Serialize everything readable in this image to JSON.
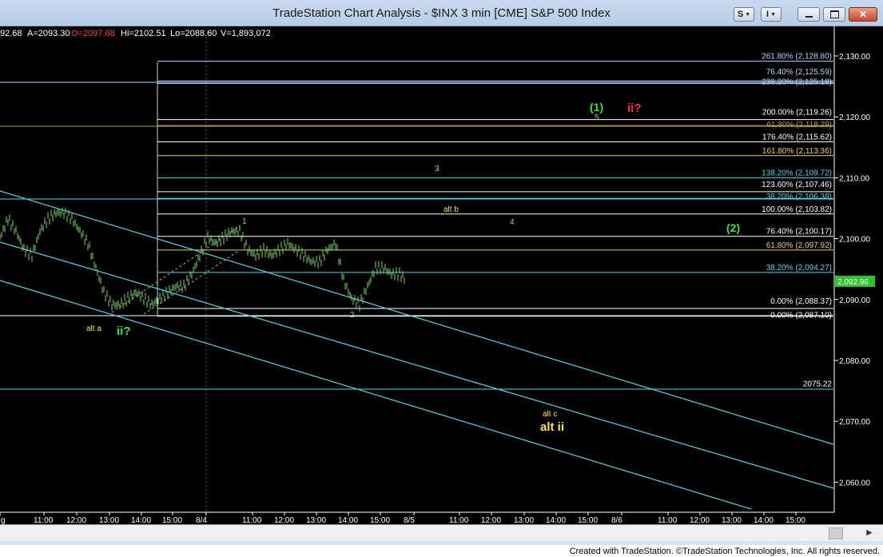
{
  "window": {
    "title": "TradeStation Chart Analysis - $INX 3 min [CME] S&P 500 Index",
    "buttons": {
      "s_label": "S",
      "i_label": "I"
    }
  },
  "status_line": {
    "close_partial": "92.68",
    "ask": "A=2093.30",
    "open": "O=2097.68",
    "high": "Hi=2102.51",
    "low": "Lo=2088.60",
    "volume": "V=1,893,072"
  },
  "price_axis": {
    "ticks": [
      "2,130.00",
      "2,120.00",
      "2,110.00",
      "2,100.00",
      "2,090.00",
      "2,080.00",
      "2,070.00",
      "2,060.00"
    ],
    "last_price": "2,092.96"
  },
  "time_axis": {
    "ticks": [
      "g",
      "11:00",
      "12:00",
      "13:00",
      "14:00",
      "15:00",
      "8/4",
      "11:00",
      "12:00",
      "13:00",
      "14:00",
      "15:00",
      "8/5",
      "11:00",
      "12:00",
      "13:00",
      "14:00",
      "15:00",
      "8/6",
      "11:00",
      "12:00",
      "13:00",
      "14:00",
      "15:00"
    ]
  },
  "fib_levels": [
    {
      "label": "261.80% (2,128.80)",
      "color": "#b8d4ff"
    },
    {
      "label": "76.40% (2,125.59)",
      "color": "#b8d4ff"
    },
    {
      "label": "238.20% (2,125.18)",
      "color": "#b8d4ff"
    },
    {
      "label": "200.00% (2,119.26)",
      "color": "#ffffff"
    },
    {
      "label": "61.80% (2,118.29)",
      "color": "#b09a5a"
    },
    {
      "label": "176.40% (2,115.62)",
      "color": "#ffffff"
    },
    {
      "label": "161.80% (2,113.36)",
      "color": "#e6d06a"
    },
    {
      "label": "138.20% (2,109.72)",
      "color": "#5fd0e6"
    },
    {
      "label": "123.60% (2,107.46)",
      "color": "#ffffff"
    },
    {
      "label": "38.20% (2,106.38)",
      "color": "#5fd0e6"
    },
    {
      "label": "100.00% (2,103.82)",
      "color": "#ffffff"
    },
    {
      "label": "76.40% (2,100.17)",
      "color": "#ffffff"
    },
    {
      "label": "61.80% (2,097.92)",
      "color": "#e6d06a"
    },
    {
      "label": "38.20% (2,094.27)",
      "color": "#5fd0e6"
    },
    {
      "label": "0.00% (2,088.37)",
      "color": "#ffffff"
    },
    {
      "label": "0.00% (2,087.10)",
      "color": "#ffffff"
    },
    {
      "label": "2075.22",
      "color": "#ffffff"
    }
  ],
  "wave_labels": {
    "w1": "1",
    "w2": "2",
    "w3": "3",
    "w4": "4",
    "w5": "5",
    "wave1_paren": "(1)",
    "wave2_paren": "(2)",
    "ii_q_red": "ii?",
    "ii_q_green": "ii?",
    "alt_a": "alt a",
    "alt_b": "alt b",
    "alt_c": "alt c",
    "alt_ii": "alt ii"
  },
  "footer": "Created with TradeStation. ©TradeStation Technologies, Inc. All rights reserved."
}
